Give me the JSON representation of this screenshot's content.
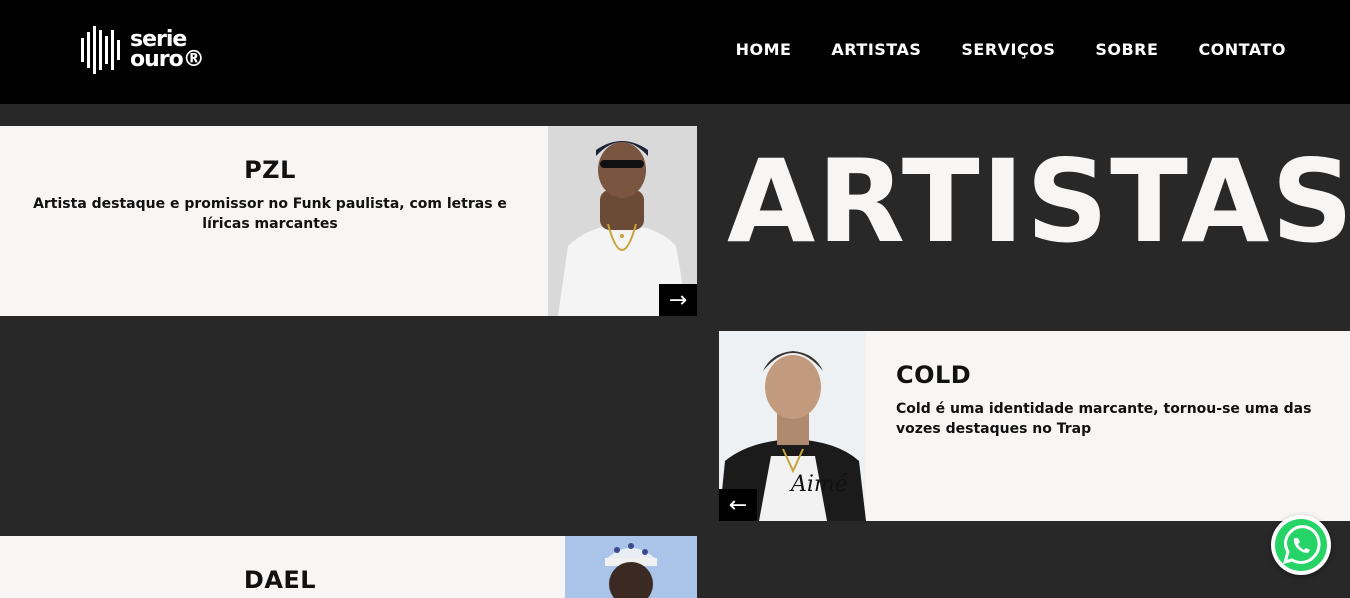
{
  "header": {
    "logo": {
      "line1": "serie",
      "line2": "ouro®",
      "icon": "sound-bars-icon"
    },
    "nav": [
      "HOME",
      "ARTISTAS",
      "SERVIÇOS",
      "SOBRE",
      "CONTATO"
    ]
  },
  "page_title": "ARTISTAS",
  "artists": [
    {
      "name": "PZL",
      "description": "Artista destaque e promissor no Funk paulista, com letras e líricas marcantes",
      "arrow": "→"
    },
    {
      "name": "COLD",
      "description": "Cold é uma identidade marcante, tornou-se uma das vozes destaques no Trap",
      "arrow": "←"
    },
    {
      "name": "DAEL",
      "description": ""
    }
  ],
  "colors": {
    "background": "#282828",
    "header": "#000000",
    "card": "#f8f6f4",
    "whatsapp": "#25d366"
  },
  "floating": {
    "icon": "whatsapp-icon"
  }
}
